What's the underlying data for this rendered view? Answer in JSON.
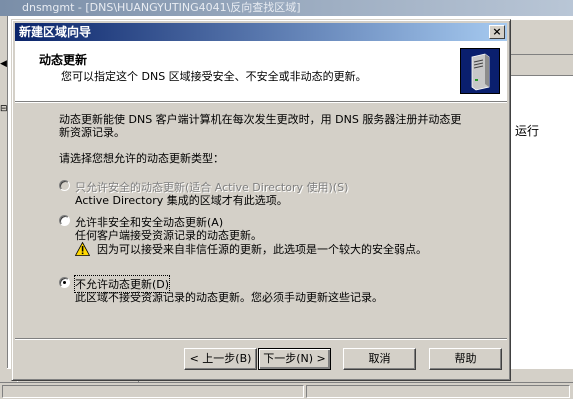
{
  "background_window": {
    "title": "dnsmgmt - [DNS\\HUANGYUTING4041\\反向查找区域]",
    "side_text": "运行"
  },
  "dialog": {
    "title": "新建区域向导",
    "close_label": "×",
    "header": {
      "title": "动态更新",
      "subtitle": "您可以指定这个 DNS 区域接受安全、不安全或非动态的更新。",
      "icon": "server-tower-icon"
    },
    "intro_line1": "动态更新能使 DNS 客户端计算机在每次发生更改时，用 DNS 服务器注册并动态更",
    "intro_line2": "新资源记录。",
    "prompt": "请选择您想允许的动态更新类型：",
    "options": [
      {
        "label": "只允许安全的动态更新(适合 Active Directory 使用)(S)",
        "description": "Active Directory 集成的区域才有此选项。",
        "selected": false,
        "enabled": false
      },
      {
        "label": "允许非安全和安全动态更新(A)",
        "description": "任何客户端接受资源记录的动态更新。",
        "warning": "因为可以接受来自非信任源的更新，此选项是一个较大的安全弱点。",
        "selected": false,
        "enabled": true
      },
      {
        "label": "不允许动态更新(D)",
        "description": "此区域不接受资源记录的动态更新。您必须手动更新这些记录。",
        "selected": true,
        "enabled": true
      }
    ],
    "buttons": {
      "back": "< 上一步(B)",
      "next": "下一步(N) >",
      "cancel": "取消",
      "help": "帮助"
    }
  },
  "colors": {
    "title_gradient_start": "#0a246a",
    "title_gradient_end": "#a6caf0",
    "face": "#d4d0c8",
    "warning_yellow": "#ffd800"
  }
}
